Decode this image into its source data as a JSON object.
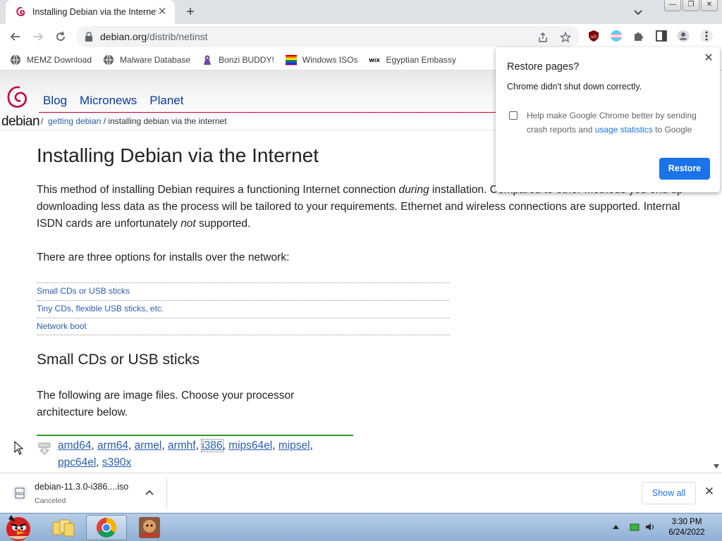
{
  "tab": {
    "title": "Installing Debian via the Internet",
    "close_glyph": "✕"
  },
  "new_tab_glyph": "+",
  "window_buttons": [
    "—",
    "❐",
    "✕"
  ],
  "omnibox": {
    "domain": "debian.org",
    "path": "/distrib/netinst"
  },
  "bookmarks": [
    {
      "label": "MEMZ Download",
      "icon": "globe-icon"
    },
    {
      "label": "Malware Database",
      "icon": "globe-icon"
    },
    {
      "label": "Bonzi BUDDY!",
      "icon": "bonzi-icon"
    },
    {
      "label": "Windows ISOs",
      "icon": "windows-flag-icon"
    },
    {
      "label": "Egyptian Embassy",
      "icon": "wix-icon"
    }
  ],
  "site": {
    "logo_text": "debian",
    "nav": [
      "Blog",
      "Micronews",
      "Planet"
    ],
    "breadcrumb": {
      "sep": "/",
      "link": "getting debian",
      "current": "/ installing debian via the internet"
    }
  },
  "article": {
    "title": "Installing Debian via the Internet",
    "intro_1": "This method of installing Debian requires a functioning Internet connection ",
    "intro_em": "during",
    "intro_2": " installation. Compared to other methods you end up downloading less data as the process will be tailored to your requirements. Ethernet and wireless connections are supported. Internal ISDN cards are unfortunately ",
    "intro_not": "not",
    "intro_3": " supported.",
    "options_text": "There are three options for installs over the network:",
    "toc": [
      "Small CDs or USB sticks",
      "Tiny CDs, flexible USB sticks, etc.",
      "Network boot"
    ],
    "section_title": "Small CDs or USB sticks",
    "section_text": "The following are image files. Choose your processor architecture below.",
    "architectures": [
      "amd64",
      "arm64",
      "armel",
      "armhf",
      "i386",
      "mips64el",
      "mipsel",
      "ppc64el",
      "s390x"
    ]
  },
  "restore_popup": {
    "title": "Restore pages?",
    "message": "Chrome didn't shut down correctly.",
    "checkbox_text_1": "Help make Google Chrome better by sending crash reports and ",
    "checkbox_link": "usage statistics",
    "checkbox_text_2": " to Google",
    "checkbox_checked": false,
    "button": "Restore",
    "close_glyph": "✕"
  },
  "download": {
    "filename": "debian-11.3.0-i386....iso",
    "status": "Canceled",
    "show_all": "Show all",
    "close_glyph": "✕"
  },
  "taskbar": {
    "time": "3:30 PM",
    "date": "6/24/2022"
  },
  "colors": {
    "chrome_blue": "#1a73e8",
    "debian_red": "#c70036",
    "link_blue": "#2a5db0",
    "green_rule": "#2e9a27"
  }
}
